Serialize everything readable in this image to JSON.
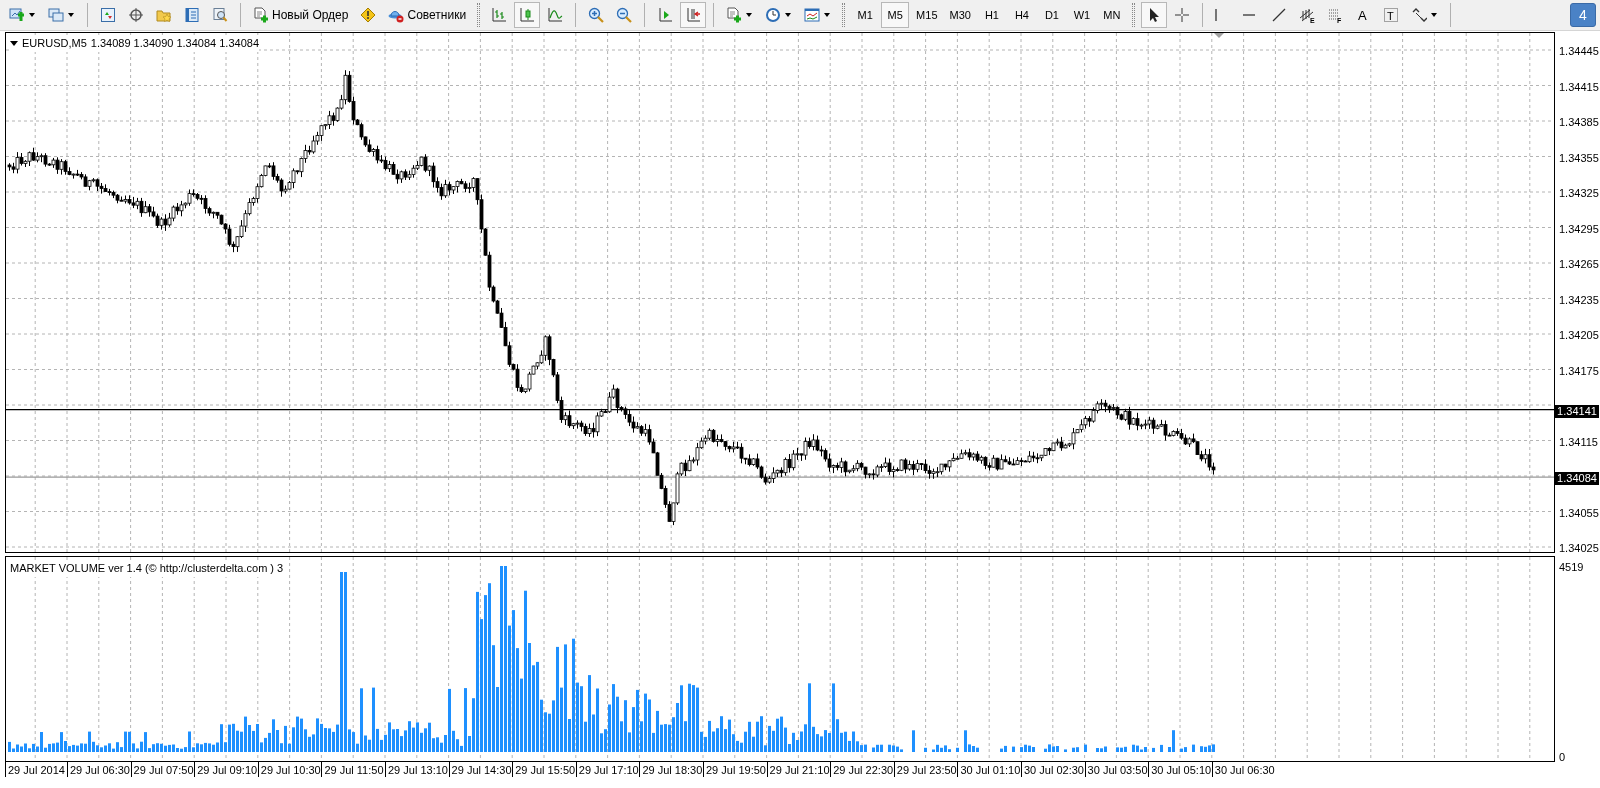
{
  "toolbar": {
    "order_button": "Новый Ордер",
    "experts_button": "Советники",
    "chart_types": [
      {
        "kind": "bars",
        "selected": false
      },
      {
        "kind": "candles",
        "selected": true
      },
      {
        "kind": "line",
        "selected": false
      }
    ],
    "shift_buttons": [
      {
        "kind": "autoscroll",
        "selected": false
      },
      {
        "kind": "shift",
        "selected": true
      }
    ],
    "timeframes": [
      {
        "label": "M1",
        "selected": false
      },
      {
        "label": "M5",
        "selected": true
      },
      {
        "label": "M15",
        "selected": false
      },
      {
        "label": "M30",
        "selected": false
      },
      {
        "label": "H1",
        "selected": false
      },
      {
        "label": "H4",
        "selected": false
      },
      {
        "label": "D1",
        "selected": false
      },
      {
        "label": "W1",
        "selected": false
      },
      {
        "label": "MN",
        "selected": false
      }
    ],
    "cursor_tools": [
      {
        "kind": "pointer",
        "selected": true
      },
      {
        "kind": "crosshair",
        "selected": false
      }
    ],
    "drawing_tools": [
      {
        "kind": "vline"
      },
      {
        "kind": "hline"
      },
      {
        "kind": "trend"
      },
      {
        "kind": "channel",
        "letter": "E"
      },
      {
        "kind": "fibo",
        "letter": "F"
      },
      {
        "kind": "text",
        "letter": "A"
      },
      {
        "kind": "label",
        "letter": "T"
      },
      {
        "kind": "arrows"
      }
    ],
    "notification_count": "4"
  },
  "chart": {
    "symbol": "EURUSD,M5",
    "quotes": "1.34089 1.34090 1.34084 1.34084",
    "price_axis": [
      "1.34445",
      "1.34415",
      "1.34385",
      "1.34355",
      "1.34325",
      "1.34295",
      "1.34265",
      "1.34235",
      "1.34205",
      "1.34175",
      "1.34115",
      "1.34055",
      "1.34025"
    ],
    "price_markers": [
      {
        "kind": "level",
        "label": "1.34141"
      },
      {
        "kind": "bid",
        "label": "1.34084"
      }
    ],
    "time_axis": [
      "29 Jul 2014",
      "29 Jul 06:30",
      "29 Jul 07:50",
      "29 Jul 09:10",
      "29 Jul 10:30",
      "29 Jul 11:50",
      "29 Jul 13:10",
      "29 Jul 14:30",
      "29 Jul 15:50",
      "29 Jul 17:10",
      "29 Jul 18:30",
      "29 Jul 19:50",
      "29 Jul 21:10",
      "29 Jul 22:30",
      "29 Jul 23:50",
      "30 Jul 01:10",
      "30 Jul 02:30",
      "30 Jul 03:50",
      "30 Jul 05:10",
      "30 Jul 06:30"
    ]
  },
  "indicator": {
    "title": "MARKET VOLUME ver 1.4 (© http://clusterdelta.com ) 3",
    "scale_max": "4519",
    "scale_min": "0"
  }
}
